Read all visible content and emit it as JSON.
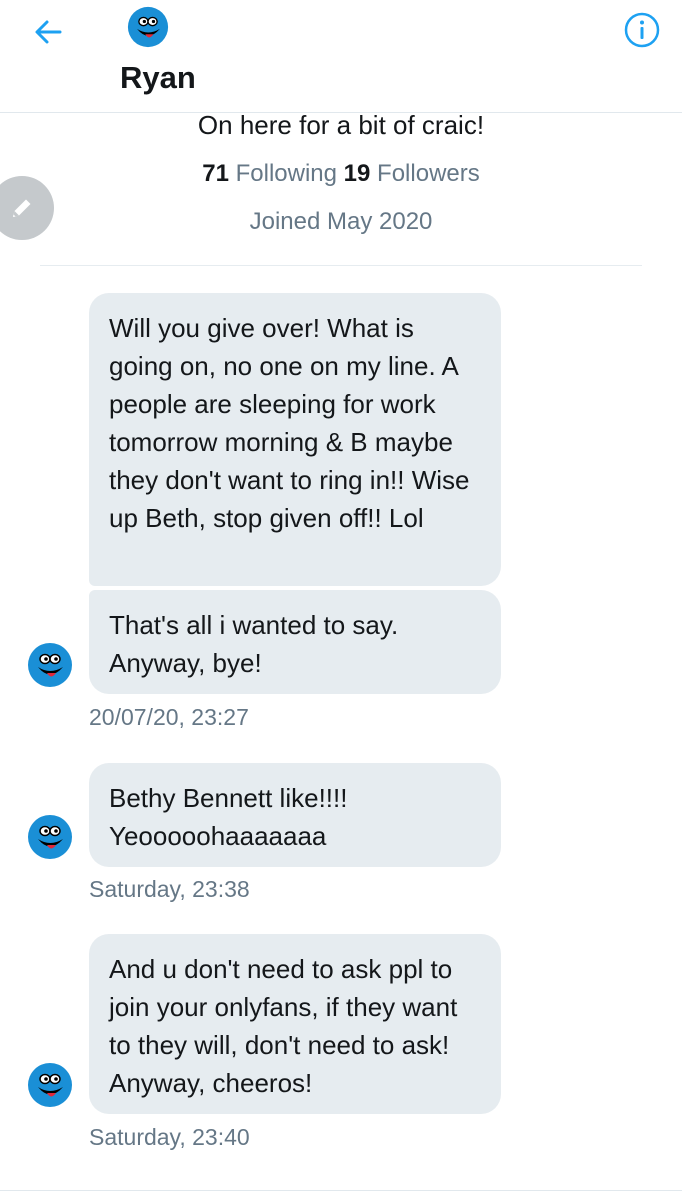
{
  "header": {
    "name": "Ryan"
  },
  "profile": {
    "bio": "On here for a bit of craic!",
    "following_count": "71",
    "following_label": "Following",
    "followers_count": "19",
    "followers_label": "Followers",
    "joined": "Joined May 2020"
  },
  "messages": [
    {
      "text": "Will you give over! What is going on, no one on my line. A people are sleeping for work tomorrow morning & B maybe they don't want to ring in!! Wise up Beth, stop given off!! Lol"
    },
    {
      "text": "That's all i wanted to say. Anyway, bye!",
      "timestamp": "20/07/20, 23:27"
    },
    {
      "text": "Bethy Bennett like!!!!\nYeooooohaaaaaaa",
      "timestamp": "Saturday, 23:38"
    },
    {
      "text": "And u don't need to ask ppl to join your onlyfans, if they want to they will, don't need to ask! Anyway, cheeros!",
      "timestamp": "Saturday, 23:40"
    }
  ],
  "colors": {
    "accent": "#1da1f2",
    "bubble": "#e6ecf0",
    "muted": "#657786",
    "avatar_blue": "#1a8fd6"
  },
  "icons": [
    "back-arrow-icon",
    "info-icon",
    "compose-icon",
    "avatar-smiley"
  ]
}
